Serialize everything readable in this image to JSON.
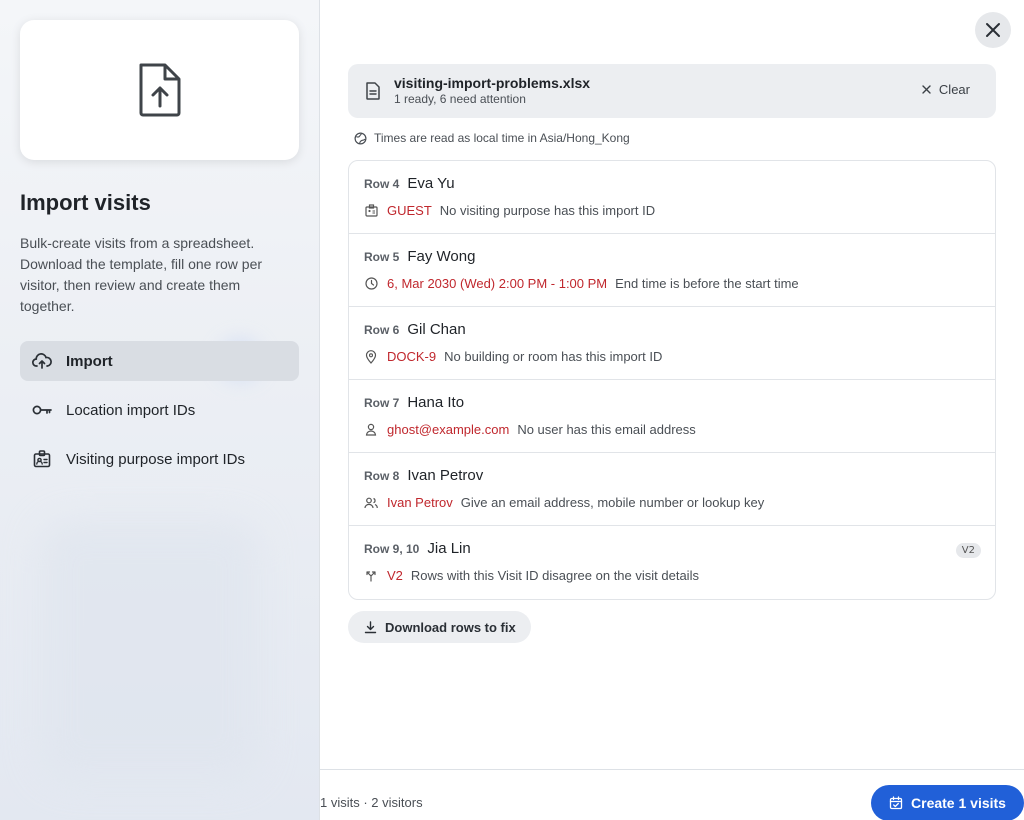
{
  "sidebar": {
    "title": "Import visits",
    "description": "Bulk-create visits from a spreadsheet. Download the template, fill one row per visitor, then review and create them together.",
    "hero_icon": "file-upload-icon",
    "items": [
      {
        "label": "Import",
        "icon": "cloud-upload-icon",
        "active": true
      },
      {
        "label": "Location import IDs",
        "icon": "key-icon",
        "active": false
      },
      {
        "label": "Visiting purpose import IDs",
        "icon": "id-badge-icon",
        "active": false
      }
    ]
  },
  "file": {
    "name": "visiting-import-problems.xlsx",
    "status": "1 ready, 6 need attention",
    "clear_label": "Clear"
  },
  "timezone_note": "Times are read as local time in Asia/Hong_Kong",
  "issues": [
    {
      "row": "Row 4",
      "name": "Eva Yu",
      "icon": "badge-icon",
      "value": "GUEST",
      "message": "No visiting purpose has this import ID"
    },
    {
      "row": "Row 5",
      "name": "Fay Wong",
      "icon": "clock-icon",
      "value": "6, Mar 2030 (Wed) 2:00 PM - 1:00 PM",
      "message": "End time is before the start time"
    },
    {
      "row": "Row 6",
      "name": "Gil Chan",
      "icon": "location-pin-icon",
      "value": "DOCK-9",
      "message": "No building or room has this import ID"
    },
    {
      "row": "Row 7",
      "name": "Hana Ito",
      "icon": "person-icon",
      "value": "ghost@example.com",
      "message": "No user has this email address"
    },
    {
      "row": "Row 8",
      "name": "Ivan Petrov",
      "icon": "people-icon",
      "value": "Ivan Petrov",
      "message": "Give an email address, mobile number or lookup key"
    },
    {
      "row": "Row 9, 10",
      "name": "Jia Lin",
      "icon": "split-icon",
      "value": "V2",
      "message": "Rows with this Visit ID disagree on the visit details",
      "badge": "V2"
    }
  ],
  "download_label": "Download rows to fix",
  "footer": {
    "summary": "1 visits · 2 visitors",
    "create_label": "Create 1 visits"
  },
  "colors": {
    "accent": "#2160d8",
    "error": "#c0272d"
  }
}
